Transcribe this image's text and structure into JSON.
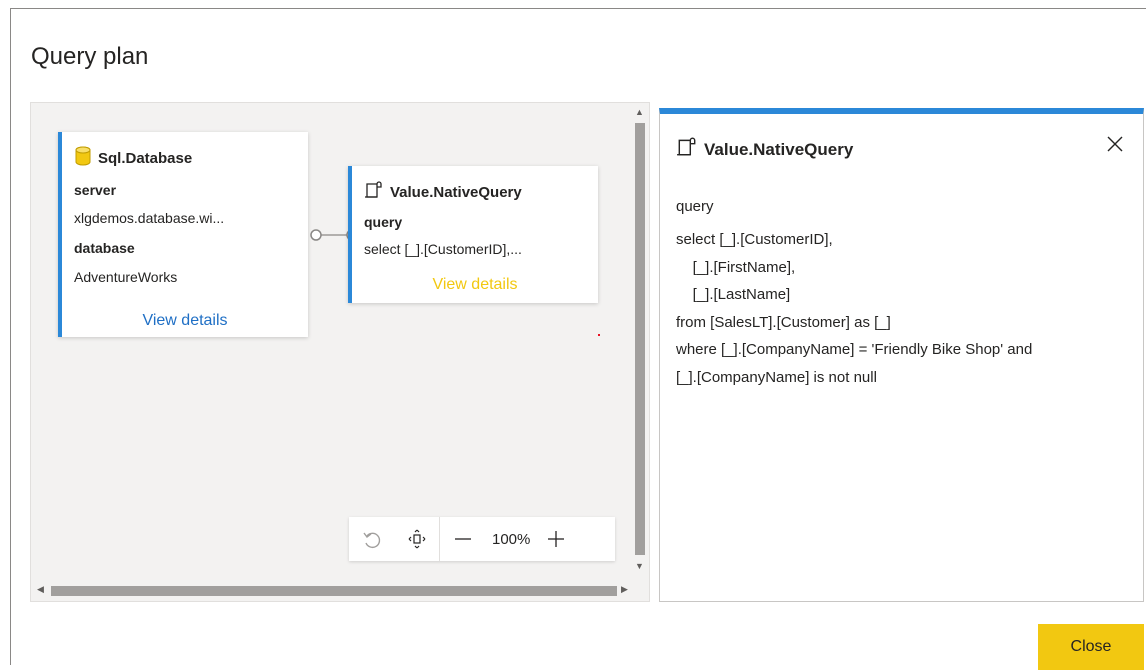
{
  "dialog": {
    "title": "Query plan",
    "close_button": "Close"
  },
  "colors": {
    "accent_blue": "#2b88d8",
    "link_blue": "#1f6fc5",
    "highlight_yellow": "#f2c811",
    "canvas_bg": "#f3f2f1"
  },
  "nodes": [
    {
      "title": "Sql.Database",
      "icon": "database-icon",
      "fields": [
        {
          "label": "server",
          "value": "xlgdemos.database.wi..."
        },
        {
          "label": "database",
          "value": "AdventureWorks"
        }
      ],
      "link": "View details"
    },
    {
      "title": "Value.NativeQuery",
      "icon": "script-icon",
      "fields": [
        {
          "label": "query",
          "value": "select [_].[CustomerID],..."
        }
      ],
      "link": "View details"
    }
  ],
  "zoom": {
    "undo_icon": "undo-icon",
    "fit_icon": "fit-to-screen-icon",
    "zoom_out_icon": "minus-icon",
    "zoom_in_icon": "plus-icon",
    "level": "100%"
  },
  "details": {
    "title": "Value.NativeQuery",
    "icon": "script-icon",
    "close_icon": "close-icon",
    "field_label": "query",
    "query_text": "select [_].[CustomerID],\n    [_].[FirstName],\n    [_].[LastName]\nfrom [SalesLT].[Customer] as [_]\nwhere [_].[CompanyName] = 'Friendly Bike Shop' and\n[_].[CompanyName] is not null"
  }
}
